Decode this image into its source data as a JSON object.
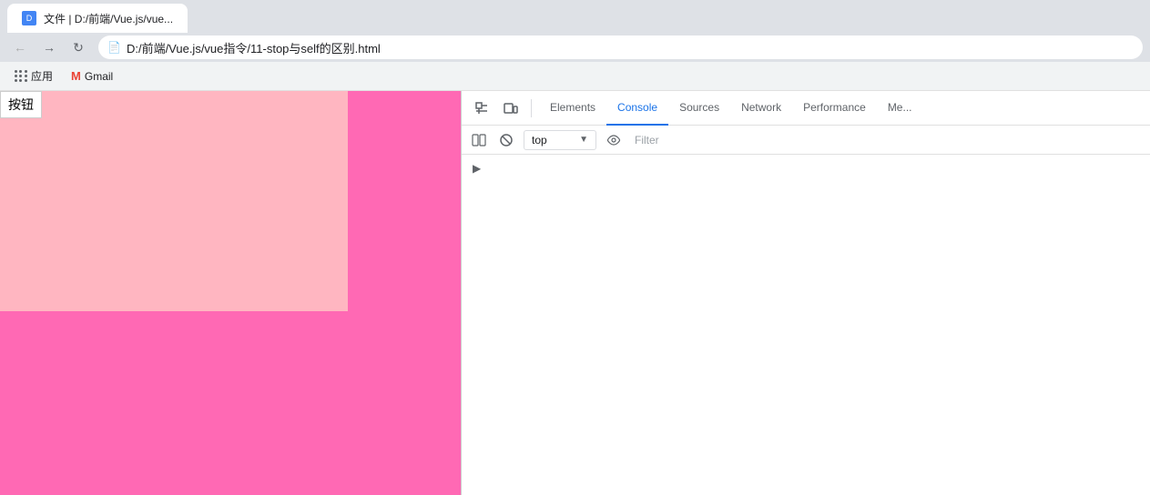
{
  "browser": {
    "title": "文件 | D:/前端/Vue.js/vue指令/11-stop与self的区别.html",
    "address": "D:/前端/Vue.js/vue指令/11-stop与self的区别.html",
    "file_icon": "📄",
    "nav": {
      "back_label": "←",
      "forward_label": "→",
      "reload_label": "↻"
    }
  },
  "tab": {
    "title": "文件 | D:/前端/Vue.js/vue...",
    "favicon_text": "D"
  },
  "bookmarks": [
    {
      "icon": "apps",
      "label": "应用"
    },
    {
      "icon": "gmail",
      "label": "Gmail"
    }
  ],
  "webpage": {
    "button_label": "按钮",
    "outer_color": "#ff69b4",
    "inner_color": "#ffb6c1"
  },
  "devtools": {
    "tabs": [
      {
        "label": "Elements",
        "active": false
      },
      {
        "label": "Console",
        "active": true
      },
      {
        "label": "Sources",
        "active": false
      },
      {
        "label": "Network",
        "active": false
      },
      {
        "label": "Performance",
        "active": false
      },
      {
        "label": "Me...",
        "active": false
      }
    ],
    "console_bar": {
      "dropdown_value": "top",
      "filter_placeholder": "Filter"
    }
  }
}
